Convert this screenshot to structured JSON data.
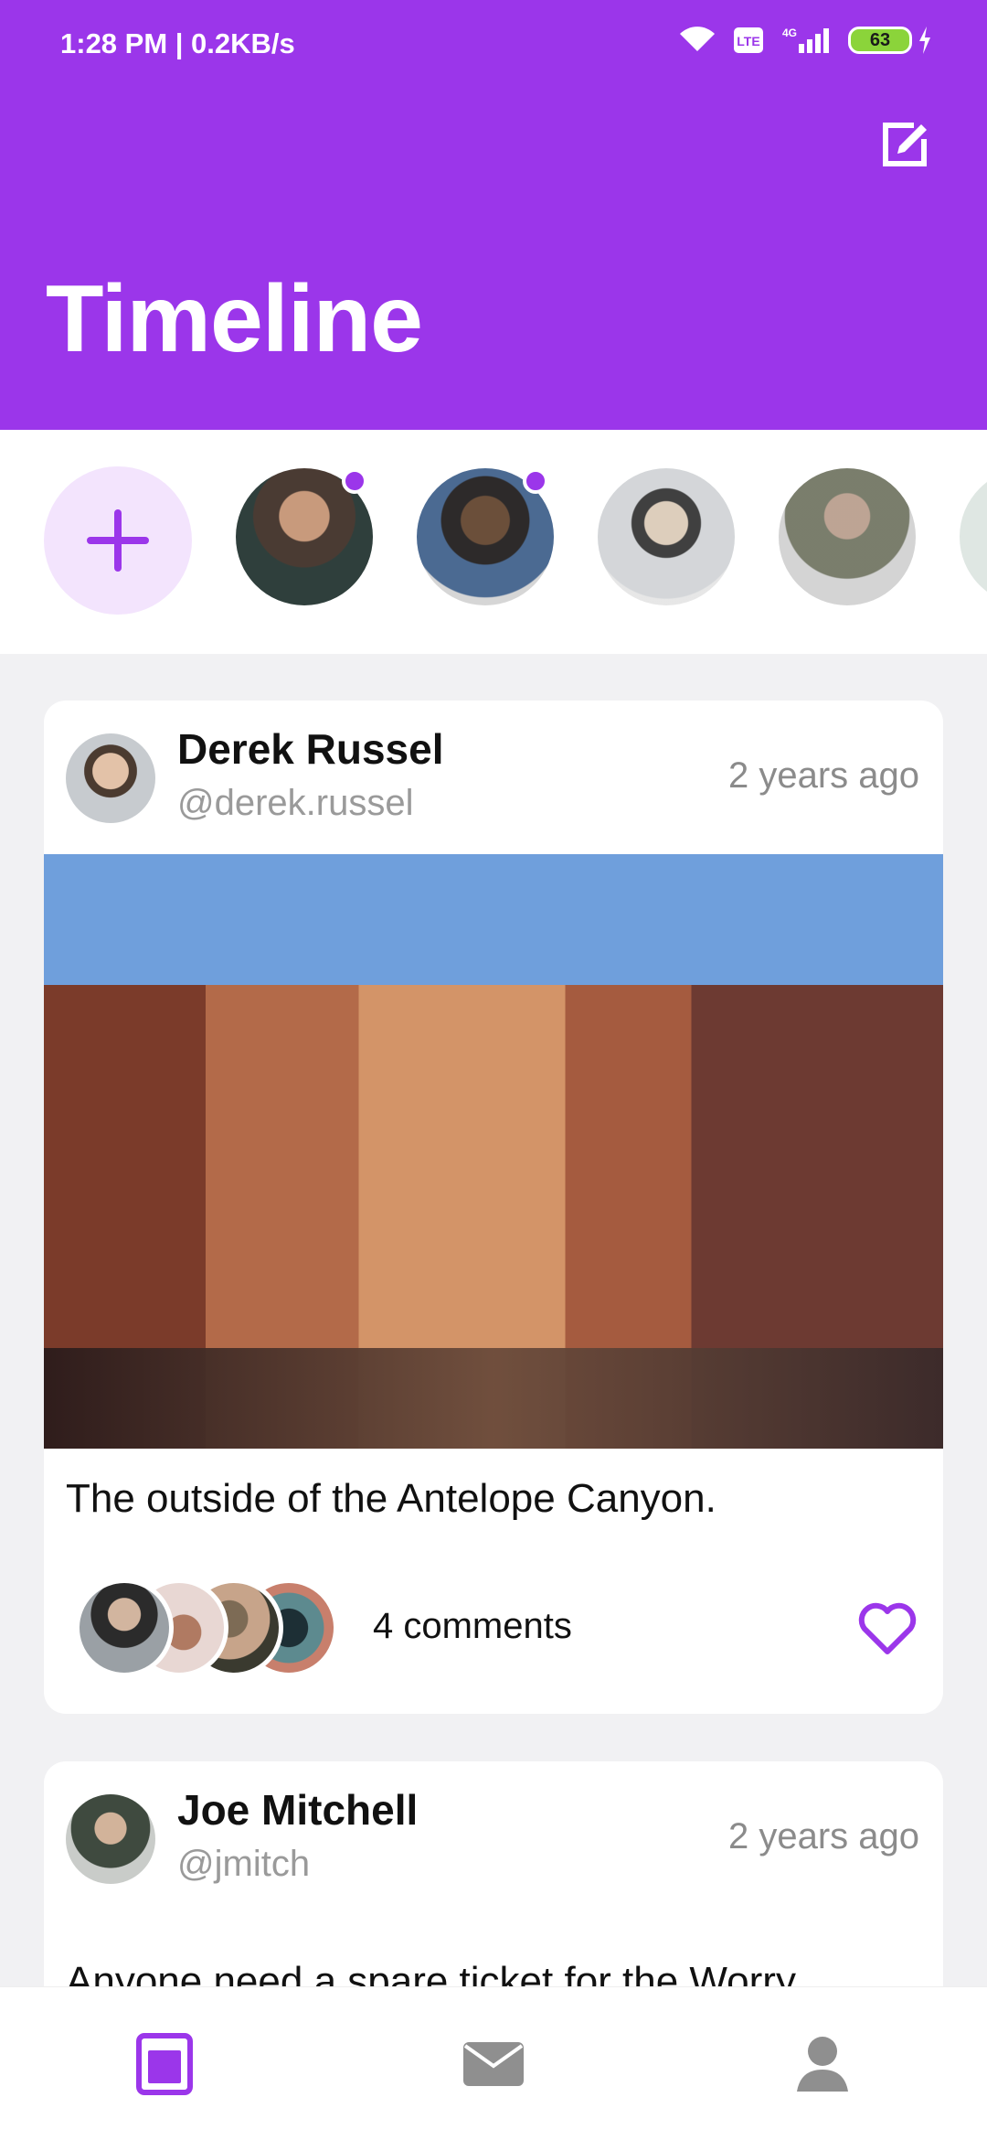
{
  "status_bar": {
    "time": "1:28 PM | 0.2KB/s",
    "battery": "63",
    "network": "4G"
  },
  "header": {
    "title": "Timeline",
    "edit_icon": "edit-icon"
  },
  "stories": {
    "add_icon": "plus-icon"
  },
  "posts": [
    {
      "name": "Derek Russel",
      "handle": "@derek.russel",
      "time": "2 years ago",
      "caption": "The outside of the Antelope Canyon.",
      "comments": "4 comments"
    },
    {
      "name": "Joe Mitchell",
      "handle": "@jmitch",
      "time": "2 years ago",
      "caption": "Anyone need a spare ticket for the Worry"
    }
  ],
  "bottom_nav": {
    "items": [
      "timeline-icon",
      "mail-icon",
      "profile-icon"
    ]
  },
  "colors": {
    "accent": "#9b36ea",
    "accent_light": "#f3e4fd"
  }
}
